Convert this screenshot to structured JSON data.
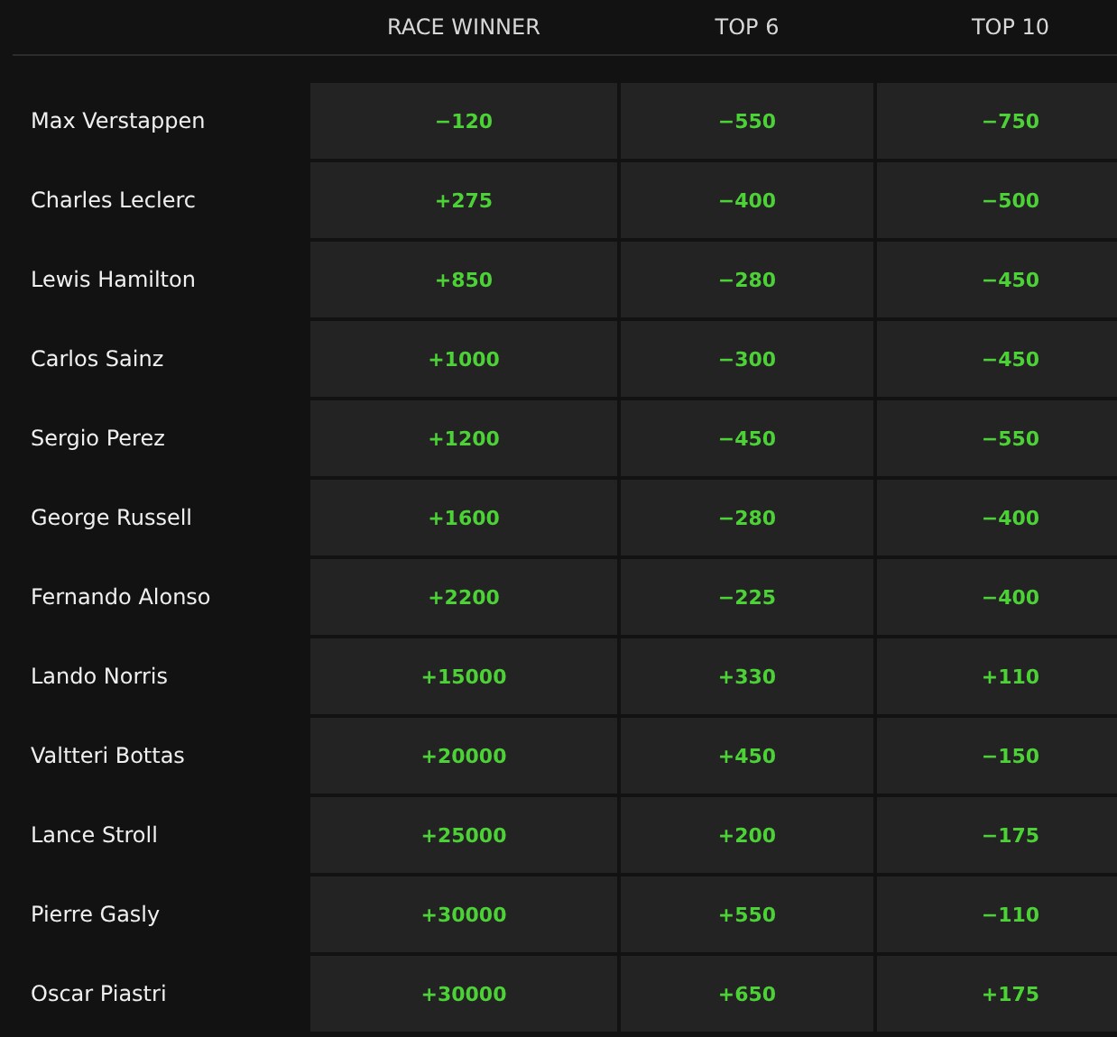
{
  "columns": [
    "RACE WINNER",
    "TOP 6",
    "TOP 10"
  ],
  "rows": [
    {
      "driver": "Max Verstappen",
      "odds": [
        "−120",
        "−550",
        "−750"
      ]
    },
    {
      "driver": "Charles Leclerc",
      "odds": [
        "+275",
        "−400",
        "−500"
      ]
    },
    {
      "driver": "Lewis Hamilton",
      "odds": [
        "+850",
        "−280",
        "−450"
      ]
    },
    {
      "driver": "Carlos Sainz",
      "odds": [
        "+1000",
        "−300",
        "−450"
      ]
    },
    {
      "driver": "Sergio Perez",
      "odds": [
        "+1200",
        "−450",
        "−550"
      ]
    },
    {
      "driver": "George Russell",
      "odds": [
        "+1600",
        "−280",
        "−400"
      ]
    },
    {
      "driver": "Fernando Alonso",
      "odds": [
        "+2200",
        "−225",
        "−400"
      ]
    },
    {
      "driver": "Lando Norris",
      "odds": [
        "+15000",
        "+330",
        "+110"
      ]
    },
    {
      "driver": "Valtteri Bottas",
      "odds": [
        "+20000",
        "+450",
        "−150"
      ]
    },
    {
      "driver": "Lance Stroll",
      "odds": [
        "+25000",
        "+200",
        "−175"
      ]
    },
    {
      "driver": "Pierre Gasly",
      "odds": [
        "+30000",
        "+550",
        "−110"
      ]
    },
    {
      "driver": "Oscar Piastri",
      "odds": [
        "+30000",
        "+650",
        "+175"
      ]
    }
  ]
}
